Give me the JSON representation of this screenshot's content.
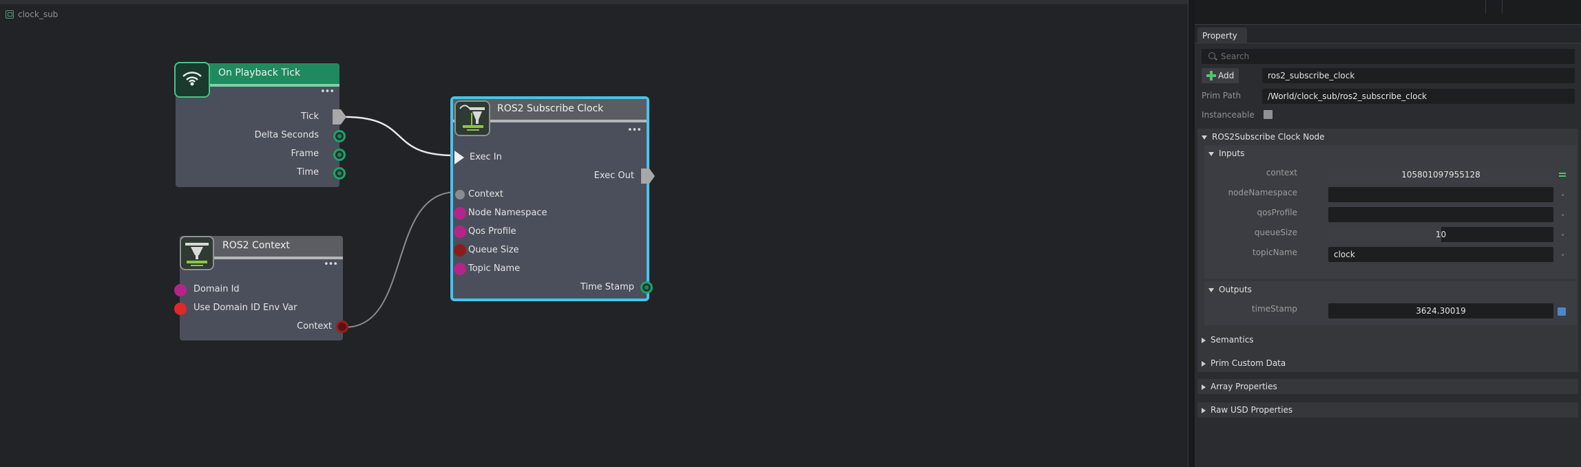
{
  "graph": {
    "tab_label": "clock_sub",
    "nodes": {
      "playback_tick": {
        "title": "On Playback Tick",
        "dots": "•••",
        "ports": {
          "tick": "Tick",
          "delta_seconds": "Delta Seconds",
          "frame": "Frame",
          "time": "Time"
        }
      },
      "ros2_context": {
        "title": "ROS2 Context",
        "dots": "•••",
        "ports": {
          "domain_id": "Domain Id",
          "use_domain_id_env_var": "Use Domain ID Env Var",
          "context": "Context"
        }
      },
      "subscribe_clock": {
        "title": "ROS2 Subscribe Clock",
        "dots": "•••",
        "ports": {
          "exec_in": "Exec In",
          "exec_out": "Exec Out",
          "context": "Context",
          "node_namespace": "Node Namespace",
          "qos_profile": "Qos Profile",
          "queue_size": "Queue Size",
          "topic_name": "Topic Name",
          "time_stamp": "Time Stamp"
        }
      }
    }
  },
  "panel": {
    "tab": "Property",
    "search_placeholder": "Search",
    "add_label": "Add",
    "prim_name": "ros2_subscribe_clock",
    "prim_path_label": "Prim Path",
    "prim_path": "/World/clock_sub/ros2_subscribe_clock",
    "instanceable_label": "Instanceable",
    "node_section": "ROS2Subscribe Clock Node",
    "inputs_section": "Inputs",
    "inputs": {
      "context": {
        "label": "context",
        "value": "105801097955128"
      },
      "nodeNamespace": {
        "label": "nodeNamespace",
        "value": ""
      },
      "qosProfile": {
        "label": "qosProfile",
        "value": ""
      },
      "queueSize": {
        "label": "queueSize",
        "value": "10"
      },
      "topicName": {
        "label": "topicName",
        "value": "clock"
      }
    },
    "outputs_section": "Outputs",
    "outputs": {
      "timeStamp": {
        "label": "timeStamp",
        "value": "3624.30019"
      }
    },
    "collapsed_sections": [
      "Semantics",
      "Prim Custom Data",
      "Array Properties",
      "Raw USD Properties"
    ]
  },
  "colors": {
    "playback_header": "#1f8a5e",
    "selection_outline": "#46c3ee",
    "exec_port": "#a8a8a8",
    "string_port": "#b5248a",
    "uint_port": "#8c1c1c",
    "bool_port": "#e02828",
    "double_port": "#18a46a"
  }
}
